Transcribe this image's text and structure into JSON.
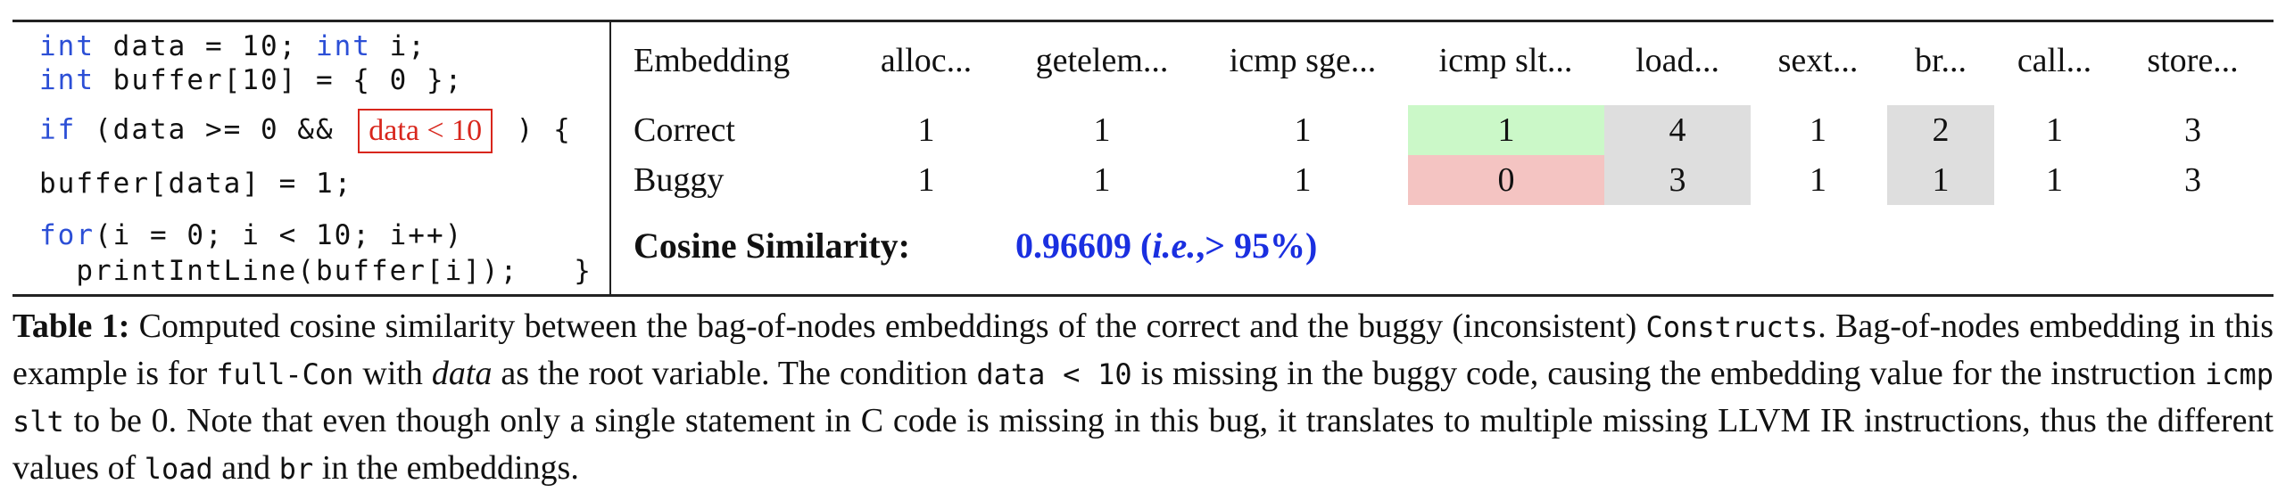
{
  "code": {
    "line1": {
      "kw1": "int",
      "t1": " data = 10; ",
      "kw2": "int",
      "t2": " i;"
    },
    "line2": {
      "kw": "int",
      "t": " buffer[10] = { 0 };"
    },
    "line3": {
      "kw": "if",
      "t1": " (data >= 0 && ",
      "boxed": "data < 10",
      "t2": " ) {"
    },
    "line4": "buffer[data] = 1;",
    "line5": {
      "kw": "for",
      "t": "(i = 0; i < 10; i++)"
    },
    "line6": "  printIntLine(buffer[i]);   }"
  },
  "table": {
    "header_label": "Embedding",
    "columns": [
      "alloc...",
      "getelem...",
      "icmp sge...",
      "icmp slt...",
      "load...",
      "sext...",
      "br...",
      "call...",
      "store..."
    ],
    "rows": [
      {
        "label": "Correct",
        "values": [
          "1",
          "1",
          "1",
          "1",
          "4",
          "1",
          "2",
          "1",
          "3"
        ]
      },
      {
        "label": "Buggy",
        "values": [
          "1",
          "1",
          "1",
          "0",
          "3",
          "1",
          "1",
          "1",
          "3"
        ]
      }
    ],
    "highlight_colors": {
      "correct_slt": "#cbf8c8",
      "buggy_slt": "#f4c4c2",
      "differing": "#dedede"
    },
    "cosine_label": "Cosine Similarity:",
    "cosine_value": "0.96609",
    "cosine_note_open": " (",
    "cosine_note_ie": "i.e.",
    "cosine_note_rest": ",> 95%)"
  },
  "caption": {
    "lead": "Table 1:",
    "p1": " Computed cosine similarity between the bag-of-nodes embeddings of the correct and the buggy (inconsistent) ",
    "c1": "Constructs",
    "p2": ". Bag-of-nodes embedding in this example is for ",
    "c2": "full-Con",
    "p3": " with ",
    "e1": "data",
    "p4": " as the root variable. The condition ",
    "c3": "data < 10",
    "p5": " is missing in the buggy code, causing the embedding value for the instruction ",
    "c4": "icmp slt",
    "p6": " to be 0. Note that even though only a single statement in C code is missing in this bug, it translates to multiple missing LLVM IR instructions, thus the different values of ",
    "c5": "load",
    "p7": " and ",
    "c6": "br",
    "p8": " in the embeddings."
  }
}
